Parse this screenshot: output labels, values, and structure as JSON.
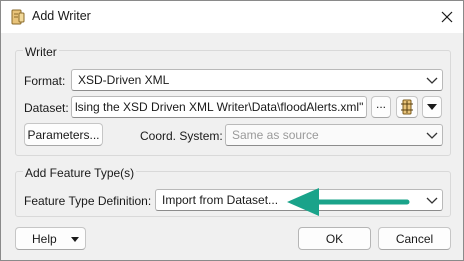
{
  "dialog": {
    "title": "Add Writer",
    "icons": {
      "app": "writer-app-icon",
      "close": "close-icon"
    }
  },
  "writer_group": {
    "label": "Writer",
    "format": {
      "label": "Format:",
      "value": "XSD-Driven XML"
    },
    "dataset": {
      "label": "Dataset:",
      "value": "lsing the XSD Driven XML Writer\\Data\\floodAlerts.xml\"",
      "browse_label": "..."
    },
    "parameters_label": "Parameters...",
    "coord_system": {
      "label": "Coord. System:",
      "value": "Same as source"
    }
  },
  "feature_group": {
    "label": "Add Feature Type(s)",
    "definition": {
      "label": "Feature Type Definition:",
      "value": "Import from Dataset..."
    },
    "annotation_color": "#1aa38a"
  },
  "footer": {
    "help_label": "Help",
    "ok_label": "OK",
    "cancel_label": "Cancel"
  }
}
